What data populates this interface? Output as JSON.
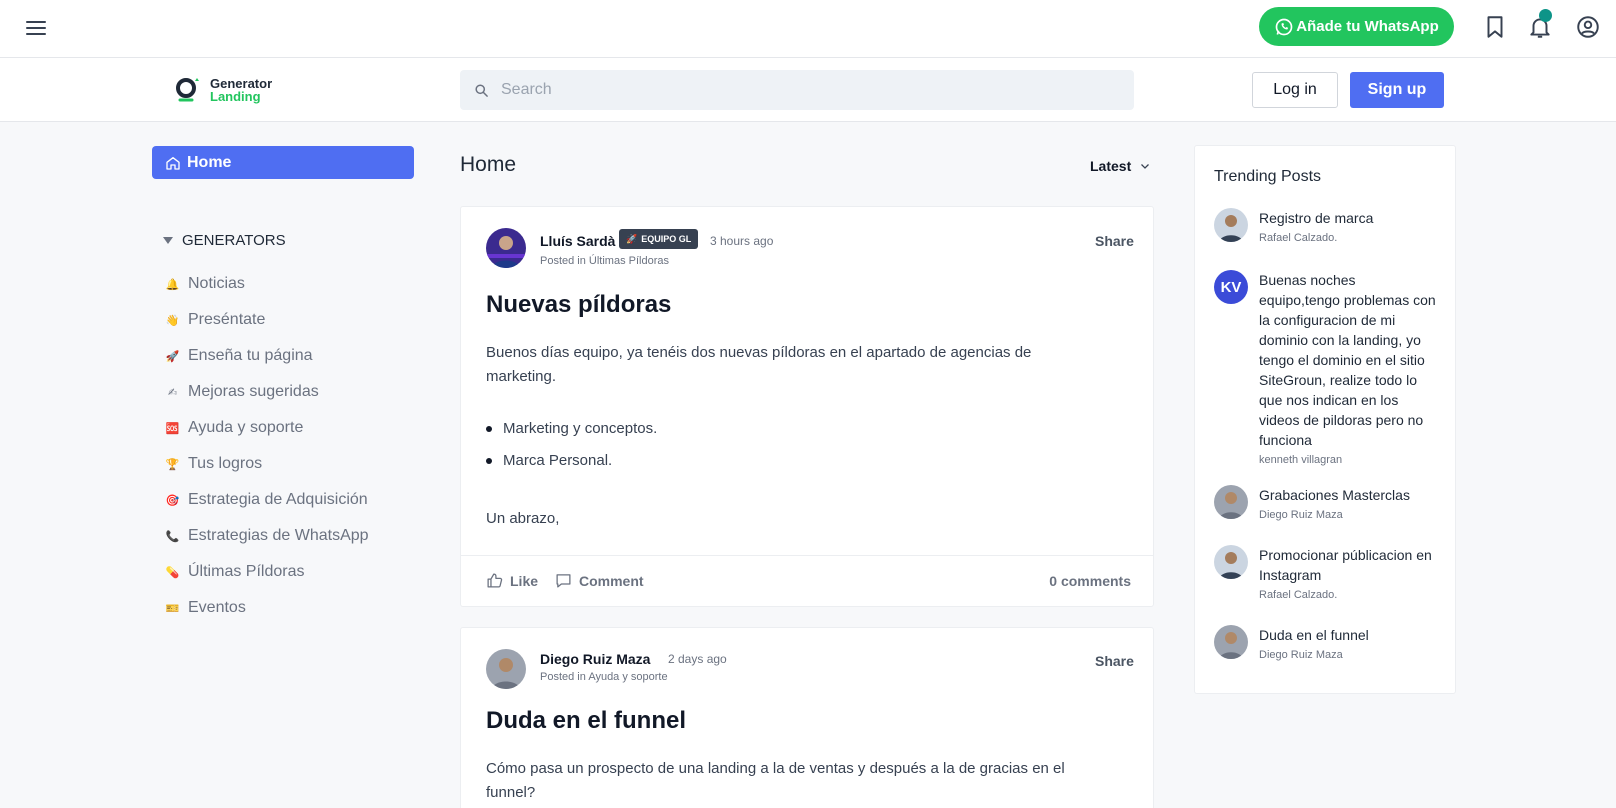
{
  "topbar": {
    "whatsapp_label": "Añade tu WhatsApp"
  },
  "header": {
    "logo_line1": "Generator",
    "logo_line2": "Landing",
    "search_placeholder": "Search",
    "login_label": "Log in",
    "signup_label": "Sign up"
  },
  "sidebar": {
    "home_label": "Home",
    "section_label": "GENERATORS",
    "items": [
      {
        "icon": "🔔",
        "label": "Noticias"
      },
      {
        "icon": "👋",
        "label": "Preséntate"
      },
      {
        "icon": "🚀",
        "label": "Enseña tu página"
      },
      {
        "icon": "✍",
        "label": "Mejoras sugeridas"
      },
      {
        "icon": "🆘",
        "label": "Ayuda y soporte"
      },
      {
        "icon": "🏆",
        "label": "Tus logros"
      },
      {
        "icon": "🎯",
        "label": "Estrategia de Adquisición"
      },
      {
        "icon": "📞",
        "label": "Estrategias de WhatsApp"
      },
      {
        "icon": "💊",
        "label": "Últimas Píldoras"
      },
      {
        "icon": "🎫",
        "label": "Eventos"
      }
    ]
  },
  "feed": {
    "title": "Home",
    "sort_label": "Latest",
    "posts": [
      {
        "author": "Lluís Sardà",
        "badge": "EQUIPO GL",
        "time": "3 hours ago",
        "posted_in": "Posted in Últimas Píldoras",
        "share_label": "Share",
        "title": "Nuevas píldoras",
        "paragraph": "Buenos días equipo, ya tenéis dos nuevas píldoras en el apartado de agencias de marketing.",
        "bullets": [
          "Marketing y conceptos.",
          "Marca Personal."
        ],
        "closing": "Un abrazo,",
        "like_label": "Like",
        "comment_label": "Comment",
        "comments_count": "0 comments"
      },
      {
        "author": "Diego Ruiz Maza",
        "time": "2 days ago",
        "posted_in": "Posted in Ayuda y soporte",
        "share_label": "Share",
        "title": "Duda en el funnel",
        "paragraph": "Cómo pasa un prospecto de una landing a la de ventas y después a la de gracias en el funnel?"
      }
    ]
  },
  "trending": {
    "title": "Trending Posts",
    "items": [
      {
        "title": "Registro de marca",
        "author": "Rafael Calzado."
      },
      {
        "initials": "KV",
        "title": "Buenas noches equipo,tengo problemas con la configuracion de mi dominio con la landing, yo tengo el dominio en el sitio SiteGroun, realize todo lo que nos indican en los videos de pildoras pero no funciona",
        "author": "kenneth villagran"
      },
      {
        "title": "Grabaciones Masterclas",
        "author": "Diego Ruiz Maza"
      },
      {
        "title": "Promocionar públicacion en Instagram",
        "author": "Rafael Calzado."
      },
      {
        "title": "Duda en el funnel",
        "author": "Diego Ruiz Maza"
      }
    ]
  },
  "colors": {
    "accent": "#4f6ef2",
    "whatsapp": "#22c55e",
    "notification": "#0d9488"
  }
}
